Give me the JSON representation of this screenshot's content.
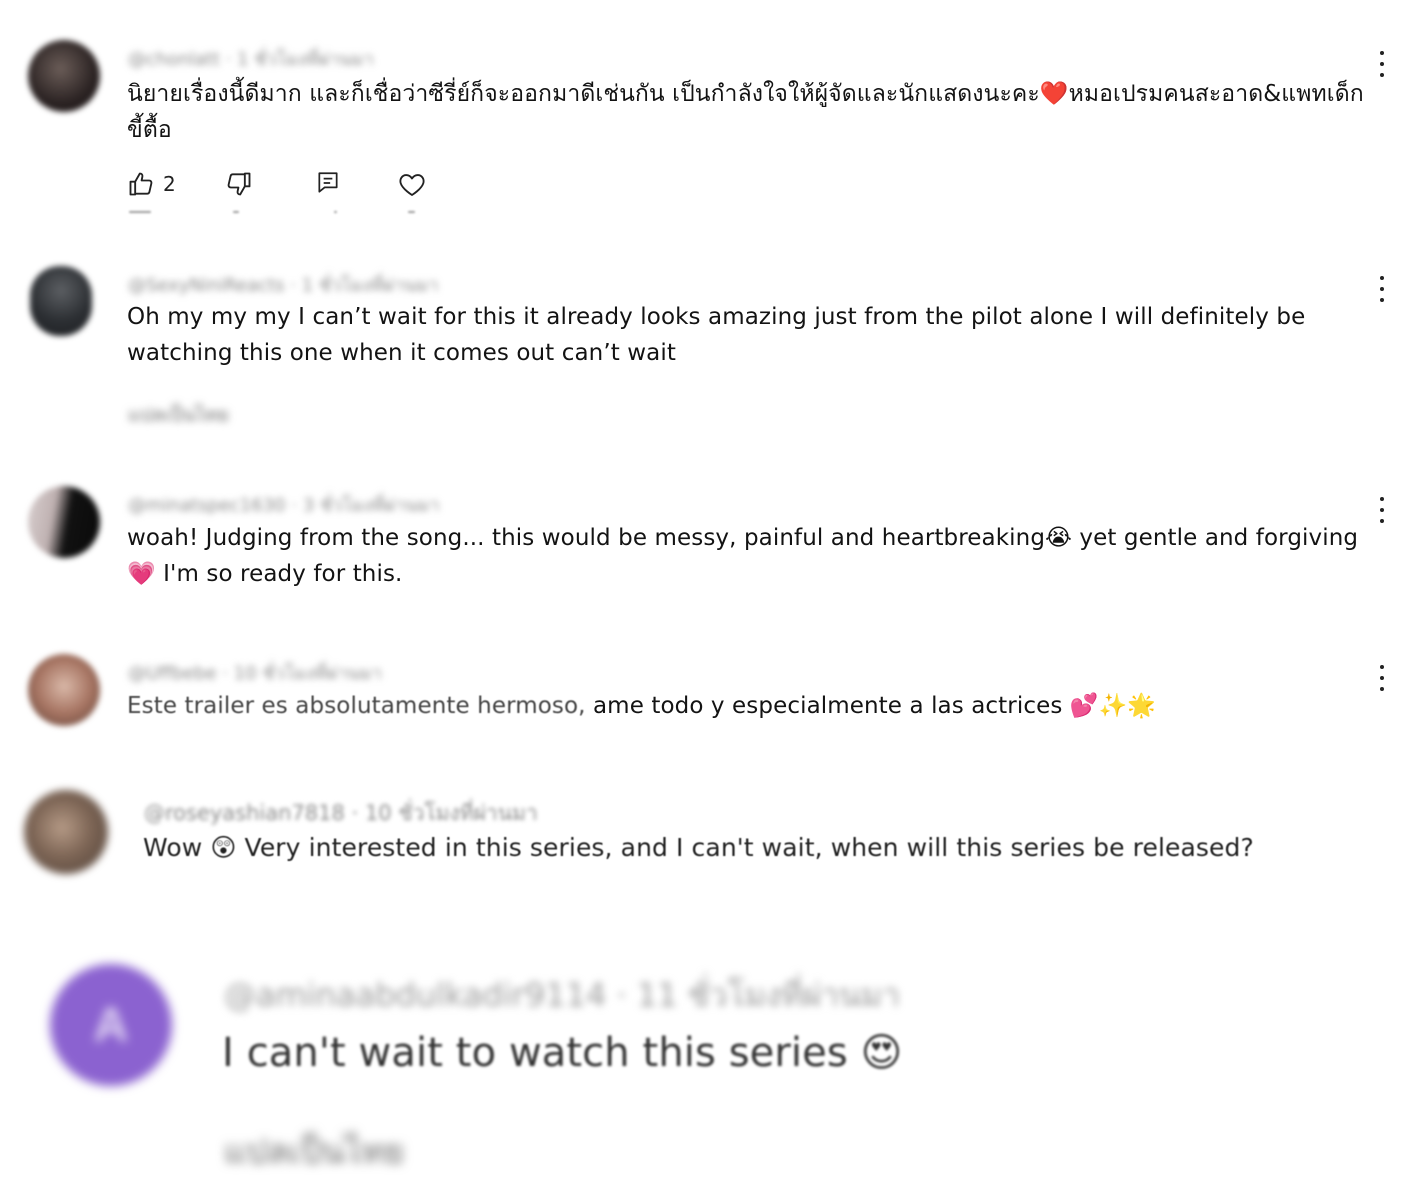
{
  "comments": [
    {
      "handle": "@chonlatt",
      "time": "1 ชั่วโมงที่ผ่านมา",
      "text": "นิยายเรื่องนี้ดีมาก และก็เชื่อว่าซีรี่ย์ก็จะออกมาดีเช่นกัน เป็นกำลังใจให้ผู้จัดและนักแสดงนะคะ❤️หมอเปรมคนสะอาด&แพทเด็กขี้ตื้อ",
      "likes": "2",
      "avatar_color": "#3b2f2f"
    },
    {
      "handle": "@SexyNiniReacts",
      "time": "1 ชั่วโมงที่ผ่านมา",
      "text": "Oh my my my I can’t wait for this it already looks amazing just from the pilot alone I will definitely be watching this one when it comes out can’t wait",
      "translate_label": "แปลเป็นไทย",
      "avatar_color": "#2e3338"
    },
    {
      "handle": "@minatspec1630",
      "time": "3 ชั่วโมงที่ผ่านมา",
      "text": "woah! Judging from the song... this would be messy, painful and heartbreaking😭 yet gentle and forgiving💗 I'm so ready for this.",
      "avatar_color": "#1f1f1f"
    },
    {
      "handle": "@Uffbebe",
      "time": "10 ชั่วโมงที่ผ่านมา",
      "text_part1": "Este trailer es absolutamente hermoso,",
      "text_part2": " ame todo y especialmente a las actrices 💕✨🌟",
      "avatar_color": "#8a5a4a"
    },
    {
      "handle": "@roseyashian7818",
      "time": "10 ชั่วโมงที่ผ่านมา",
      "text": "Wow 😲 Very interested in this series, and I can't wait, when will this series be released?",
      "avatar_color": "#6b5a4e"
    },
    {
      "handle": "@aminaabdulkadir9114",
      "time": "11 ชั่วโมงที่ผ่านมา",
      "text": "I can't wait to watch this series 😍",
      "avatar_letter": "A",
      "avatar_color": "#7e57c2",
      "translate_label": "แปลเป็นไทย"
    }
  ],
  "icons": {
    "like": "thumbs-up-icon",
    "dislike": "thumbs-down-icon",
    "reply": "reply-icon",
    "heart": "heart-icon",
    "more": "more-vert-icon"
  },
  "colors": {
    "text": "#131313",
    "meta": "#8a8a8a",
    "amina_avatar": "#7e57c2"
  }
}
